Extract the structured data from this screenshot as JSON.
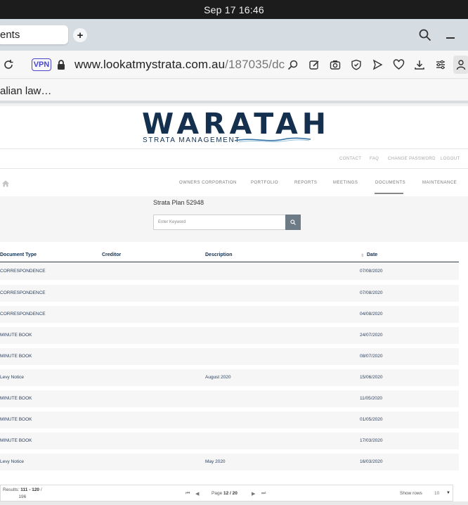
{
  "system": {
    "clock": "Sep 17  16:46"
  },
  "browser": {
    "tab_title": "ents",
    "new_tab_label": "+",
    "vpn_label": "VPN",
    "url_host": "www.lookatmystrata.com.au",
    "url_path": "/187035/dc",
    "bookmark": "alian law…"
  },
  "site": {
    "logo_main": "WARATAH",
    "logo_sub": "STRATA MANAGEMENT",
    "top_links": [
      "CONTACT",
      "FAQ",
      "CHANGE PASSWORD",
      "LOGOUT"
    ],
    "nav": [
      "OWNERS CORPORATION",
      "PORTFOLIO",
      "REPORTS",
      "MEETINGS",
      "DOCUMENTS",
      "MAINTENANCE"
    ],
    "active_nav": "DOCUMENTS",
    "plan_title": "Strata Plan 52948",
    "search_placeholder": "Enter Keyword"
  },
  "table": {
    "headers": [
      "Document Type",
      "Creditor",
      "Description",
      "Date"
    ],
    "rows": [
      {
        "type": "CORRESPONDENCE",
        "creditor": "",
        "description": "",
        "date": "07/08/2020"
      },
      {
        "type": "CORRESPONDENCE",
        "creditor": "",
        "description": "",
        "date": "07/08/2020"
      },
      {
        "type": "CORRESPONDENCE",
        "creditor": "",
        "description": "",
        "date": "04/08/2020"
      },
      {
        "type": "MINUTE BOOK",
        "creditor": "",
        "description": "",
        "date": "24/07/2020"
      },
      {
        "type": "MINUTE BOOK",
        "creditor": "",
        "description": "",
        "date": "08/07/2020"
      },
      {
        "type": "Levy Notice",
        "creditor": "",
        "description": "August 2020",
        "date": "15/06/2020"
      },
      {
        "type": "MINUTE BOOK",
        "creditor": "",
        "description": "",
        "date": "11/05/2020"
      },
      {
        "type": "MINUTE BOOK",
        "creditor": "",
        "description": "",
        "date": "01/05/2020"
      },
      {
        "type": "MINUTE BOOK",
        "creditor": "",
        "description": "",
        "date": "17/03/2020"
      },
      {
        "type": "Levy Notice",
        "creditor": "",
        "description": "May 2020",
        "date": "16/03/2020"
      }
    ]
  },
  "pagination": {
    "results_prefix": "Results: ",
    "results_range": "111 - 120",
    "results_sep": " /",
    "results_total": "196",
    "page_prefix": "Page ",
    "page_current": "12 / 20",
    "show_rows_label": "Show rows",
    "show_rows_value": "10"
  }
}
